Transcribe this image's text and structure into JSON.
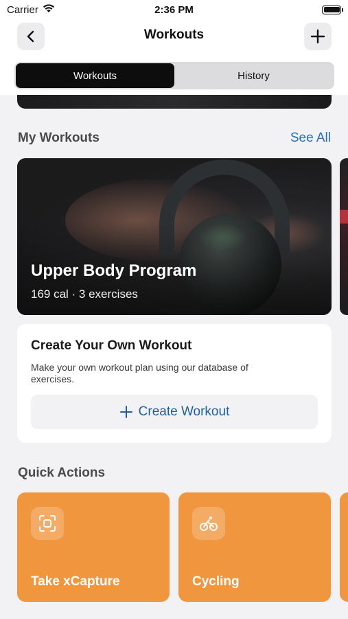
{
  "status_bar": {
    "carrier": "Carrier",
    "time": "2:36 PM"
  },
  "header": {
    "title": "Workouts"
  },
  "segments": [
    {
      "label": "Workouts",
      "active": true
    },
    {
      "label": "History",
      "active": false
    }
  ],
  "my_workouts": {
    "title": "My Workouts",
    "see_all": "See All",
    "cards": [
      {
        "title": "Upper Body Program",
        "meta": "169 cal · 3 exercises"
      }
    ]
  },
  "create_workout": {
    "title": "Create Your Own Workout",
    "description": "Make your own workout plan using our database of exercises.",
    "button_label": "Create Workout"
  },
  "quick_actions": {
    "title": "Quick Actions",
    "items": [
      {
        "label": "Take xCapture",
        "icon": "scan-icon"
      },
      {
        "label": "Cycling",
        "icon": "bicycle-icon"
      }
    ]
  },
  "colors": {
    "accent_orange": "#f0963f",
    "link_blue": "#2a6fb0",
    "segment_active": "#0d0d0d"
  }
}
